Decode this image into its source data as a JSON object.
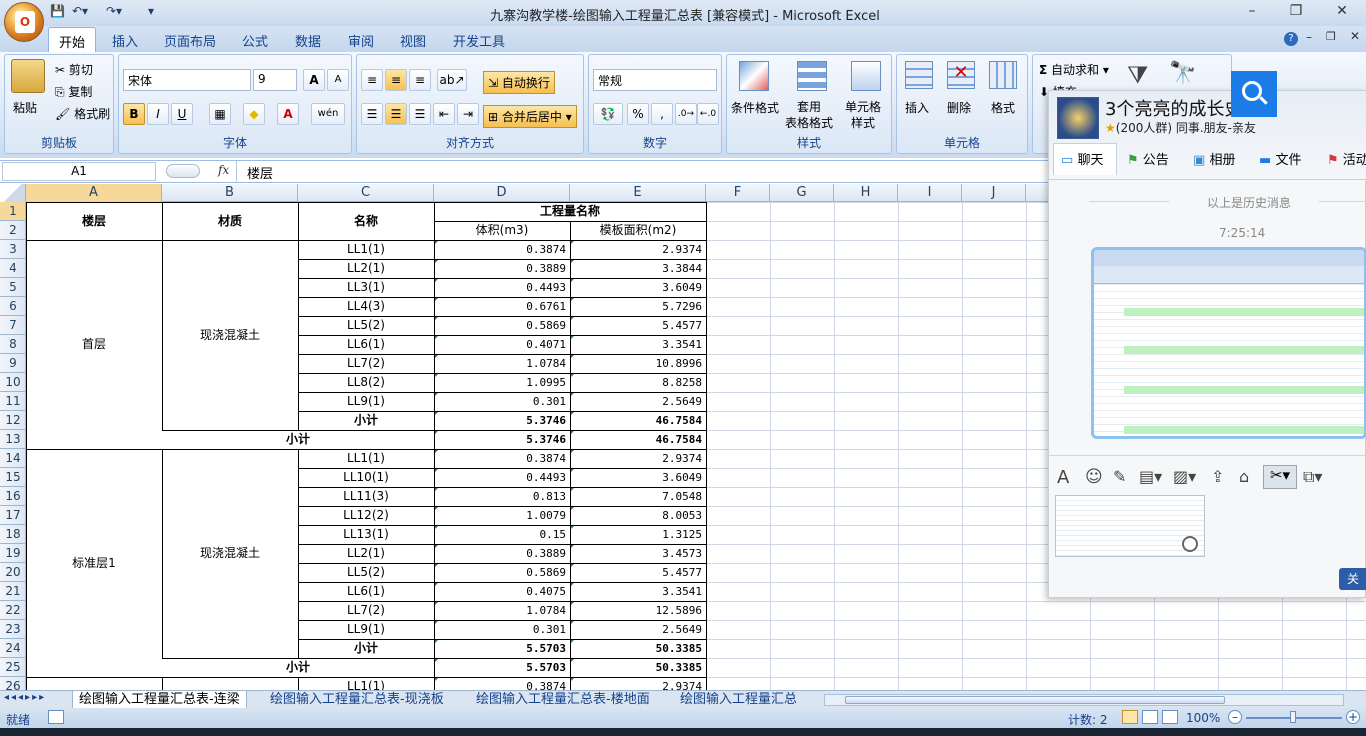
{
  "app": {
    "title": "九寨沟教学楼-绘图输入工程量汇总表  [兼容模式] - Microsoft Excel",
    "office_button": "O"
  },
  "ribbon": {
    "tabs": [
      "开始",
      "插入",
      "页面布局",
      "公式",
      "数据",
      "审阅",
      "视图",
      "开发工具"
    ],
    "clipboard": {
      "label": "剪贴板",
      "paste": "粘贴",
      "cut": "剪切",
      "copy": "复制",
      "format_painter": "格式刷"
    },
    "font": {
      "label": "字体",
      "name": "宋体",
      "size": "9",
      "bold": "B",
      "italic": "I",
      "underline": "U",
      "grow": "A",
      "shrink": "A",
      "wen": "wén"
    },
    "alignment": {
      "label": "对齐方式",
      "wrap": "自动换行",
      "merge": "合并后居中"
    },
    "number": {
      "label": "数字",
      "format": "常规",
      "percent": "%",
      "comma": ","
    },
    "styles": {
      "label": "样式",
      "conditional": "条件格式",
      "table": "套用\n表格格式",
      "cell": "单元格\n样式"
    },
    "cells": {
      "label": "单元格",
      "insert": "插入",
      "delete": "删除",
      "format": "格式"
    },
    "editing": {
      "autosum": "自动求和",
      "fill": "填充"
    }
  },
  "formula_bar": {
    "name_box": "A1",
    "fx": "fx",
    "content": "楼层"
  },
  "columns": [
    "A",
    "B",
    "C",
    "D",
    "E",
    "F",
    "G",
    "H",
    "I",
    "J"
  ],
  "rows": [
    "1",
    "2",
    "3",
    "4",
    "5",
    "6",
    "7",
    "8",
    "9",
    "10",
    "11",
    "12",
    "13",
    "14",
    "15",
    "16",
    "17",
    "18",
    "19",
    "20",
    "21",
    "22",
    "23",
    "24",
    "25",
    "26"
  ],
  "sheet": {
    "h_floor": "楼层",
    "h_material": "材质",
    "h_name": "名称",
    "h_quantity": "工程量名称",
    "h_volume": "体积(m3)",
    "h_formwork": "模板面积(m2)",
    "floor1": "首层",
    "floor2": "标准层1",
    "material1": "现浇混凝土",
    "material2": "现浇混凝土",
    "sub1": "小计",
    "sub1_total": "小计",
    "sub2": "小计",
    "sub2_total": "小计",
    "r3": [
      "LL1(1)",
      "0.3874",
      "2.9374"
    ],
    "r4": [
      "LL2(1)",
      "0.3889",
      "3.3844"
    ],
    "r5": [
      "LL3(1)",
      "0.4493",
      "3.6049"
    ],
    "r6": [
      "LL4(3)",
      "0.6761",
      "5.7296"
    ],
    "r7": [
      "LL5(2)",
      "0.5869",
      "5.4577"
    ],
    "r8": [
      "LL6(1)",
      "0.4071",
      "3.3541"
    ],
    "r9": [
      "LL7(2)",
      "1.0784",
      "10.8996"
    ],
    "r10": [
      "LL8(2)",
      "1.0995",
      "8.8258"
    ],
    "r11": [
      "LL9(1)",
      "0.301",
      "2.5649"
    ],
    "r12": [
      "5.3746",
      "46.7584"
    ],
    "r13": [
      "5.3746",
      "46.7584"
    ],
    "r14": [
      "LL1(1)",
      "0.3874",
      "2.9374"
    ],
    "r15": [
      "LL10(1)",
      "0.4493",
      "3.6049"
    ],
    "r16": [
      "LL11(3)",
      "0.813",
      "7.0548"
    ],
    "r17": [
      "LL12(2)",
      "1.0079",
      "8.0053"
    ],
    "r18": [
      "LL13(1)",
      "0.15",
      "1.3125"
    ],
    "r19": [
      "LL2(1)",
      "0.3889",
      "3.4573"
    ],
    "r20": [
      "LL5(2)",
      "0.5869",
      "5.4577"
    ],
    "r21": [
      "LL6(1)",
      "0.4075",
      "3.3541"
    ],
    "r22": [
      "LL7(2)",
      "1.0784",
      "12.5896"
    ],
    "r23": [
      "LL9(1)",
      "0.301",
      "2.5649"
    ],
    "r24": [
      "5.5703",
      "50.3385"
    ],
    "r25": [
      "5.5703",
      "50.3385"
    ],
    "r26": [
      "LL1(1)",
      "0.3874",
      "2.9374"
    ]
  },
  "sheet_tabs": [
    "绘图输入工程量汇总表-连梁",
    "绘图输入工程量汇总表-现浇板",
    "绘图输入工程量汇总表-楼地面",
    "绘图输入工程量汇总"
  ],
  "status": {
    "ready": "就绪",
    "count": "计数: 2",
    "zoom": "100%"
  },
  "qq": {
    "group_name": "3个亮亮的成长史",
    "group_info": "(200人群) 同事.朋友-亲友",
    "tabs": [
      "聊天",
      "公告",
      "相册",
      "文件",
      "活动"
    ],
    "history": "以上是历史消息",
    "time": "7:25:14",
    "close": "关"
  },
  "colors": {
    "accent": "#15428b",
    "green_tri": "#1e8c2e"
  }
}
